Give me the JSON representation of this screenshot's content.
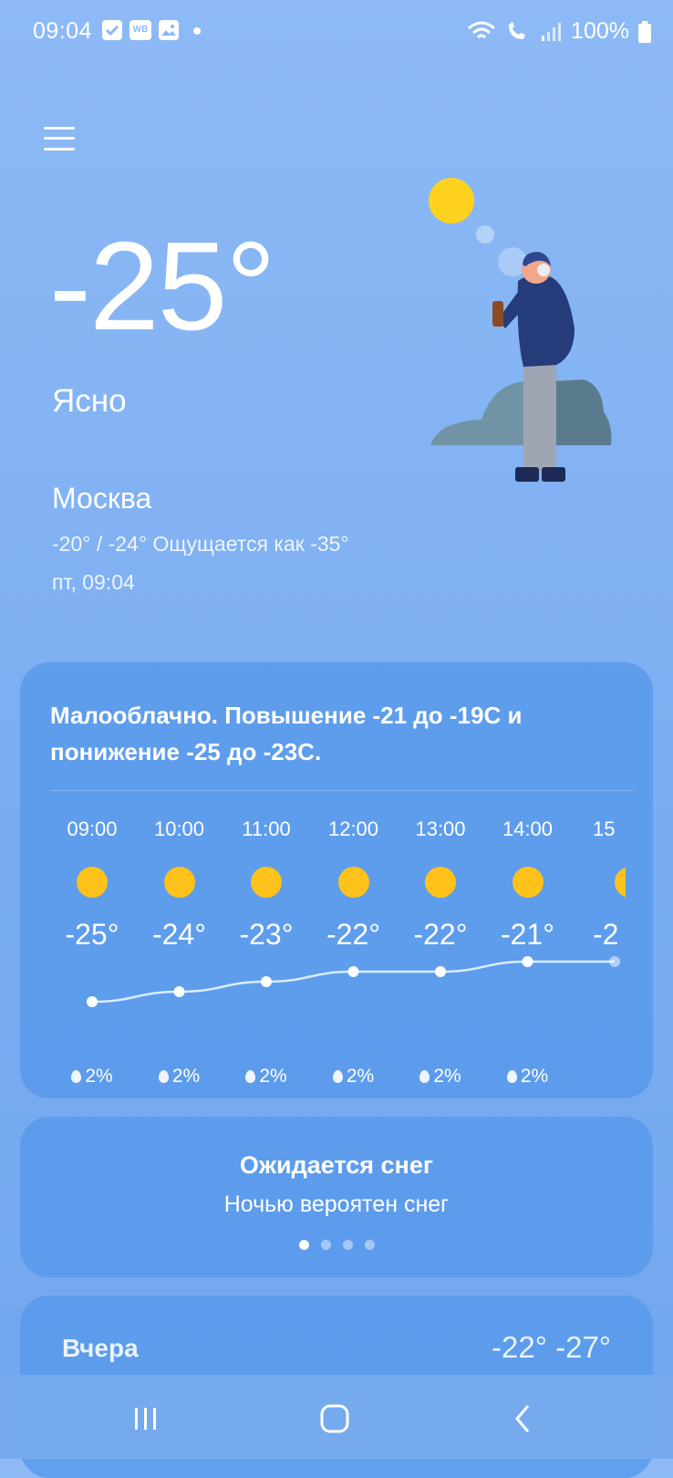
{
  "status_bar": {
    "time": "09:04",
    "notification_icons": [
      "check-icon",
      "wb-icon",
      "gallery-icon",
      "dot-icon"
    ],
    "wb_label": "WB",
    "battery": "100%"
  },
  "current": {
    "temperature": "-25°",
    "condition": "Ясно",
    "city": "Москва",
    "range_feels": "-20° / -24° Ощущается как -35°",
    "datetime": "пт, 09:04"
  },
  "forecast_card": {
    "summary": "Малооблачно. Повышение -21 до -19C и понижение -25 до -23C.",
    "hours": [
      {
        "time": "09:00",
        "temp": "-25°",
        "precip": "2%",
        "value": -25
      },
      {
        "time": "10:00",
        "temp": "-24°",
        "precip": "2%",
        "value": -24
      },
      {
        "time": "11:00",
        "temp": "-23°",
        "precip": "2%",
        "value": -23
      },
      {
        "time": "12:00",
        "temp": "-22°",
        "precip": "2%",
        "value": -22
      },
      {
        "time": "13:00",
        "temp": "-22°",
        "precip": "2%",
        "value": -22
      },
      {
        "time": "14:00",
        "temp": "-21°",
        "precip": "2%",
        "value": -21
      },
      {
        "time": "15",
        "temp": "-2",
        "precip": "",
        "value": -21
      }
    ]
  },
  "alert_card": {
    "title": "Ожидается снег",
    "subtitle": "Ночью вероятен снег",
    "pages": 4,
    "active_page": 1
  },
  "yesterday": {
    "label": "Вчера",
    "temps": "-22° -27°"
  },
  "colors": {
    "sun": "#ffc21a",
    "card": "#5698eb"
  }
}
